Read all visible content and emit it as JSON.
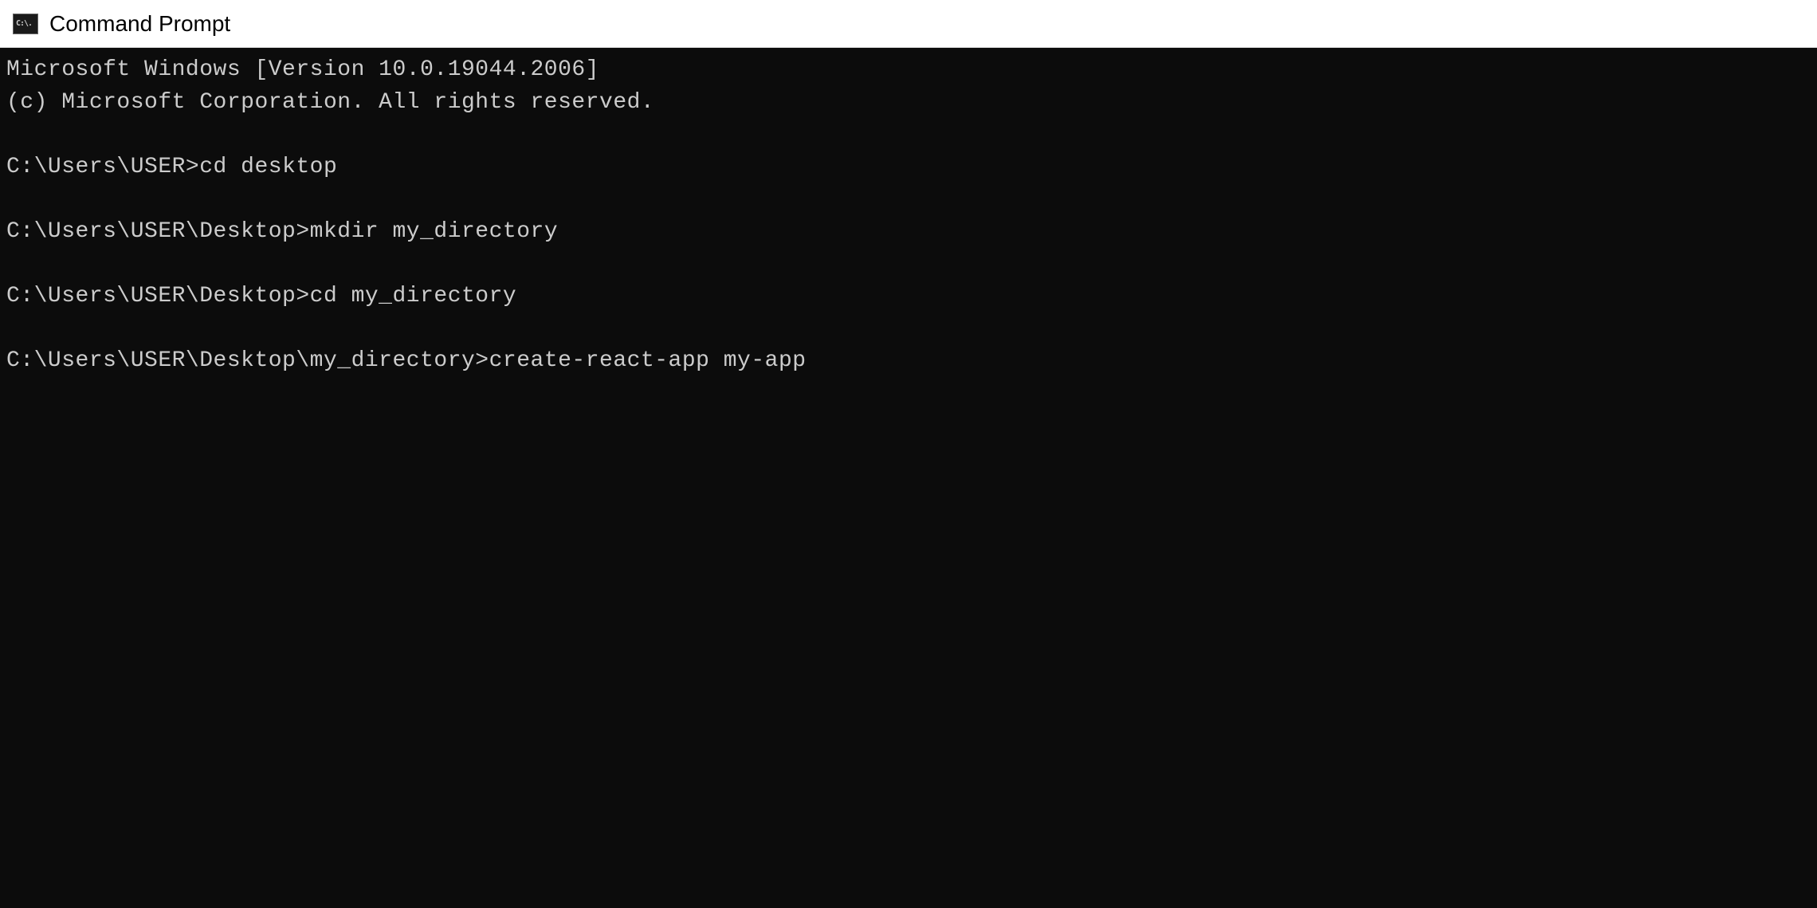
{
  "window": {
    "title": "Command Prompt",
    "icon_text": "C:\\."
  },
  "terminal": {
    "header_lines": [
      "Microsoft Windows [Version 10.0.19044.2006]",
      "(c) Microsoft Corporation. All rights reserved."
    ],
    "entries": [
      {
        "prompt": "C:\\Users\\USER>",
        "command": "cd desktop"
      },
      {
        "prompt": "C:\\Users\\USER\\Desktop>",
        "command": "mkdir my_directory"
      },
      {
        "prompt": "C:\\Users\\USER\\Desktop>",
        "command": "cd my_directory"
      },
      {
        "prompt": "C:\\Users\\USER\\Desktop\\my_directory>",
        "command": "create-react-app my-app"
      }
    ]
  }
}
